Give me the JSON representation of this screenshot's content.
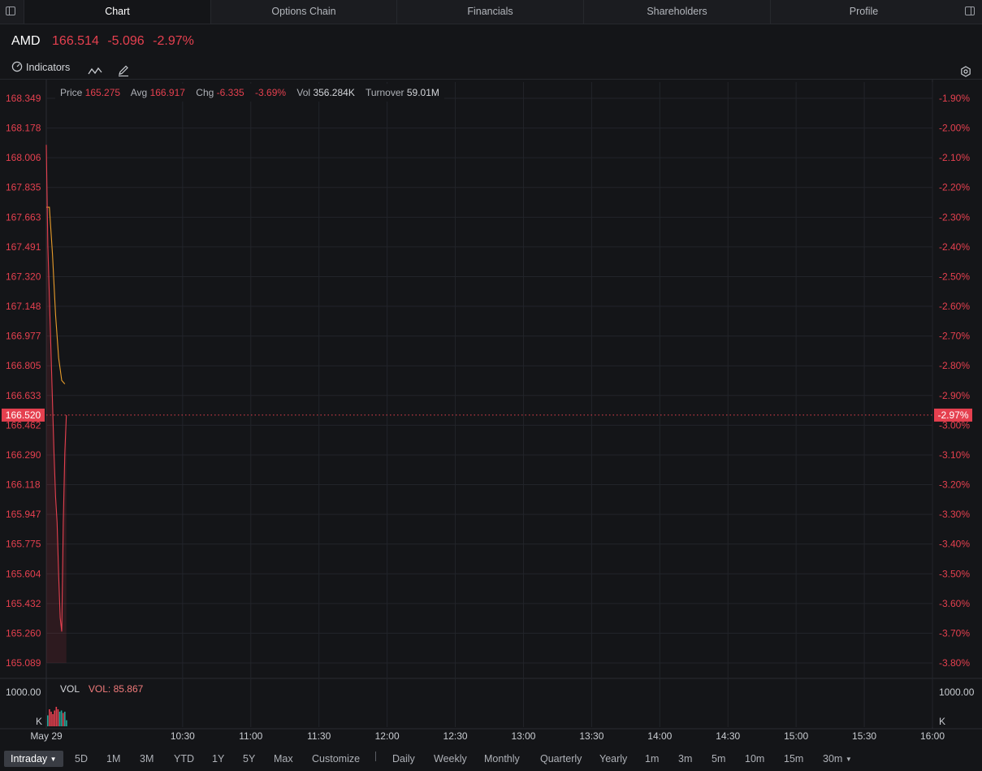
{
  "tabs": [
    "Chart",
    "Options Chain",
    "Financials",
    "Shareholders",
    "Profile"
  ],
  "quote": {
    "symbol": "AMD",
    "price": "166.514",
    "change": "-5.096",
    "change_pct": "-2.97%"
  },
  "toolbar": {
    "indicators_label": "Indicators"
  },
  "info": {
    "price_label": "Price",
    "price": "165.275",
    "avg_label": "Avg",
    "avg": "166.917",
    "chg_label": "Chg",
    "chg": "-6.335",
    "chg_pct": "-3.69%",
    "vol_label": "Vol",
    "vol": "356.284K",
    "turnover_label": "Turnover",
    "turnover": "59.01M"
  },
  "volume_panel": {
    "label": "VOL",
    "value": "VOL: 85.867",
    "top_left": "1000.00",
    "top_right": "1000.00",
    "unit_left": "K",
    "unit_right": "K"
  },
  "current": {
    "price_tag": "166.520",
    "pct_tag": "-2.97%"
  },
  "periods": [
    "Intraday",
    "5D",
    "1M",
    "3M",
    "YTD",
    "1Y",
    "5Y",
    "Max",
    "Customize"
  ],
  "intervals": [
    "Daily",
    "Weekly",
    "Monthly",
    "Quarterly",
    "Yearly",
    "1m",
    "3m",
    "5m",
    "10m",
    "15m",
    "30m"
  ],
  "colors": {
    "down": "#e5404f",
    "up": "#26a69a",
    "avg": "#e89c2b",
    "bg": "#141518",
    "grid": "#22242a"
  },
  "chart_data": {
    "type": "line",
    "x_ticks": [
      "May 29",
      "10:30",
      "11:00",
      "11:30",
      "12:00",
      "12:30",
      "13:00",
      "13:30",
      "14:00",
      "14:30",
      "15:00",
      "15:30",
      "16:00"
    ],
    "y_ticks_left": [
      "168.349",
      "168.178",
      "168.006",
      "167.835",
      "167.663",
      "167.491",
      "167.320",
      "167.148",
      "166.977",
      "166.805",
      "166.633",
      "166.462",
      "166.290",
      "166.118",
      "165.947",
      "165.775",
      "165.604",
      "165.432",
      "165.260",
      "165.089"
    ],
    "y_ticks_right": [
      "-1.90%",
      "-2.00%",
      "-2.10%",
      "-2.20%",
      "-2.30%",
      "-2.40%",
      "-2.50%",
      "-2.60%",
      "-2.70%",
      "-2.80%",
      "-2.90%",
      "-3.00%",
      "-3.10%",
      "-3.20%",
      "-3.30%",
      "-3.40%",
      "-3.50%",
      "-3.60%",
      "-3.70%",
      "-3.80%"
    ],
    "ylim": [
      165.089,
      168.349
    ],
    "price_series": {
      "name": "Price",
      "points": [
        [
          0.0,
          168.08
        ],
        [
          0.5,
          167.5
        ],
        [
          1.0,
          167.2
        ],
        [
          1.5,
          166.9
        ],
        [
          2.0,
          166.6
        ],
        [
          2.5,
          166.3
        ],
        [
          3.0,
          166.05
        ],
        [
          3.5,
          165.9
        ],
        [
          4.0,
          165.6
        ],
        [
          4.5,
          165.35
        ],
        [
          5.0,
          165.27
        ],
        [
          5.5,
          165.9
        ],
        [
          6.0,
          166.3
        ],
        [
          6.5,
          166.52
        ]
      ]
    },
    "avg_series": {
      "name": "Avg",
      "points": [
        [
          0.0,
          167.72
        ],
        [
          1.0,
          167.72
        ],
        [
          2.0,
          167.45
        ],
        [
          3.0,
          167.1
        ],
        [
          4.0,
          166.85
        ],
        [
          5.0,
          166.72
        ],
        [
          6.0,
          166.7
        ]
      ]
    },
    "volume_bars": [
      {
        "v": 0.45,
        "dir": "up"
      },
      {
        "v": 0.7,
        "dir": "down"
      },
      {
        "v": 0.6,
        "dir": "down"
      },
      {
        "v": 0.5,
        "dir": "down"
      },
      {
        "v": 0.65,
        "dir": "down"
      },
      {
        "v": 0.8,
        "dir": "down"
      },
      {
        "v": 0.7,
        "dir": "down"
      },
      {
        "v": 0.6,
        "dir": "up"
      },
      {
        "v": 0.65,
        "dir": "up"
      },
      {
        "v": 0.55,
        "dir": "down"
      },
      {
        "v": 0.6,
        "dir": "up"
      },
      {
        "v": 0.25,
        "dir": "up"
      }
    ]
  }
}
